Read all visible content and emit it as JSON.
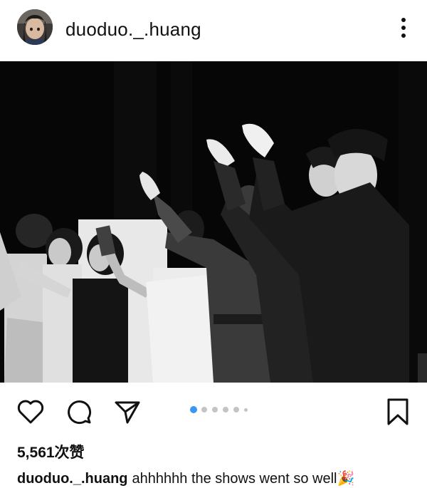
{
  "post": {
    "username": "duoduo._.huang",
    "avatar_icon": "profile-photo",
    "more_icon": "more-vertical-icon",
    "carousel": {
      "total_slides": 6,
      "active_index": 0,
      "active_color": "#3897f0",
      "inactive_color": "#c4c4c4"
    },
    "actions": {
      "like_icon": "heart-icon",
      "comment_icon": "comment-icon",
      "share_icon": "send-icon",
      "save_icon": "bookmark-icon"
    },
    "likes_text": "5,561次赞",
    "caption": {
      "username": "duoduo._.huang",
      "text": "ahhhhhh the shows went so well🎉"
    }
  }
}
